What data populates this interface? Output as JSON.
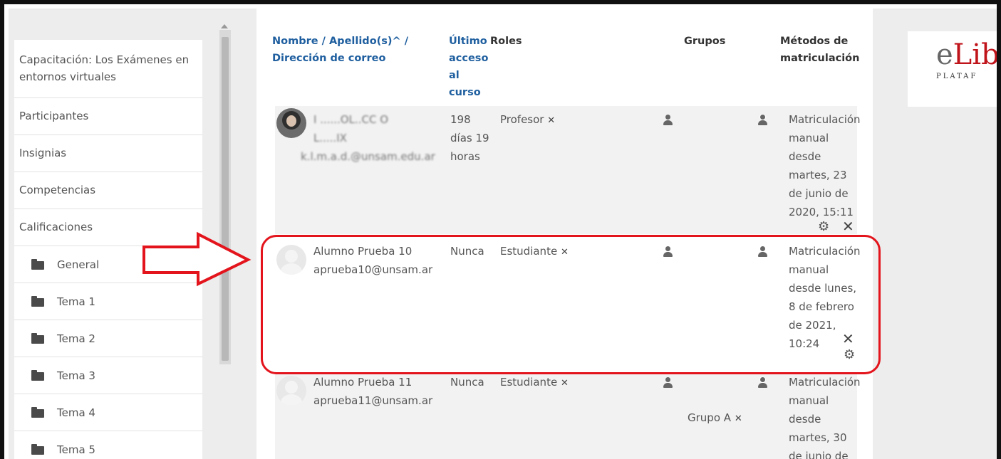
{
  "sidebar": {
    "items": [
      {
        "label": "Capacitación: Los Exámenes en entornos virtuales"
      },
      {
        "label": "Participantes"
      },
      {
        "label": "Insignias"
      },
      {
        "label": "Competencias"
      },
      {
        "label": "Calificaciones"
      }
    ],
    "folders": [
      {
        "label": "General"
      },
      {
        "label": "Tema 1"
      },
      {
        "label": "Tema 2"
      },
      {
        "label": "Tema 3"
      },
      {
        "label": "Tema 4"
      },
      {
        "label": "Tema 5"
      }
    ]
  },
  "table": {
    "headers": {
      "name": "Nombre / Apellido(s)^ /",
      "email": "Dirección de correo",
      "last_access": [
        "Último",
        "acceso",
        "al",
        "curso"
      ],
      "roles": "Roles",
      "groups": "Grupos",
      "methods": [
        "Métodos de",
        "matriculación"
      ]
    },
    "rows": [
      {
        "name_line1": "I ......OL..CC O",
        "name_line2": "L.....IX",
        "email": "k.l.m.a.d.@unsam.edu.ar",
        "last_access": [
          "198",
          "días 19",
          "horas"
        ],
        "role": "Profesor",
        "group": "",
        "method": [
          "Matriculación",
          "manual",
          "desde",
          "martes, 23",
          "de junio de",
          "2020, 15:11"
        ]
      },
      {
        "name_line1": "Alumno Prueba 10",
        "name_line2": "",
        "email": "aprueba10@unsam.ar",
        "last_access": [
          "Nunca"
        ],
        "role": "Estudiante",
        "group": "",
        "method": [
          "Matriculación",
          "manual",
          "desde lunes,",
          "8 de febrero",
          "de 2021,",
          "10:24"
        ]
      },
      {
        "name_line1": "Alumno Prueba 11",
        "name_line2": "",
        "email": "aprueba11@unsam.ar",
        "last_access": [
          "Nunca"
        ],
        "role": "Estudiante",
        "group": "Grupo A",
        "method": [
          "Matriculación",
          "manual",
          "desde",
          "martes, 30",
          "de junio de"
        ]
      }
    ]
  },
  "logo": {
    "text_a": "e",
    "text_b": "Lib",
    "sub": "PLATAF"
  },
  "colors": {
    "link": "#1f5f9f",
    "highlight": "#e3141c",
    "logo_red": "#c0141b"
  },
  "icons": {
    "remove": "x-icon",
    "settings": "gear-icon",
    "user": "user-icon",
    "group": "group-icon",
    "folder": "folder-icon"
  }
}
